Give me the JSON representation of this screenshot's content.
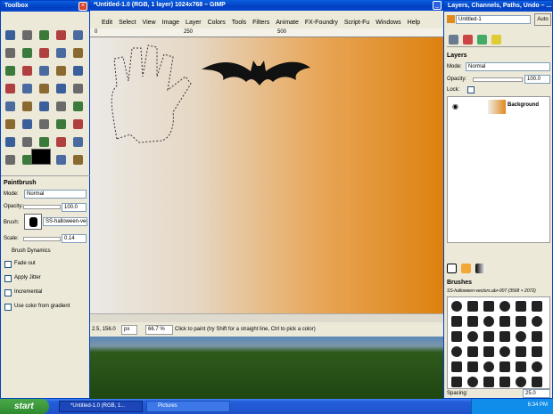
{
  "toolbox": {
    "title": "Toolbox",
    "paintbrush": "Paintbrush",
    "mode_label": "Mode:",
    "mode": "Normal",
    "opacity_label": "Opacity:",
    "opacity": "100.0",
    "brush_label": "Brush:",
    "brush": "SS-halloween-vect",
    "scale_label": "Scale:",
    "scale": "0.14",
    "dynamics": "Brush Dynamics",
    "fade": "Fade out",
    "jitter": "Apply Jitter",
    "incremental": "Incremental",
    "gradient": "Use color from gradient"
  },
  "image_window": {
    "title": "*Untitled-1.0 (RGB, 1 layer) 1024x768 – GIMP",
    "menu": [
      "Edit",
      "Select",
      "View",
      "Image",
      "Layer",
      "Colors",
      "Tools",
      "Filters",
      "Animate",
      "FX-Foundry",
      "Script-Fu",
      "Windows",
      "Help"
    ],
    "ruler": [
      "0",
      "250",
      "500"
    ],
    "coords": "2.5, 156.0",
    "unit": "px",
    "zoom": "66.7 %",
    "status": "Click to paint (try Shift for a straight line, Ctrl to pick a color)"
  },
  "dock": {
    "title": "Layers, Channels, Paths, Undo – ...",
    "image": "Untitled-1",
    "auto": "Auto",
    "layers_title": "Layers",
    "mode_label": "Mode:",
    "mode": "Normal",
    "opacity_label": "Opacity:",
    "opacity": "100.0",
    "lock_label": "Lock:",
    "layer_name": "Background",
    "brushes_title": "Brushes",
    "brush_name": "SS-halloween-vectors.abr-007 (3568 × 2072)",
    "spacing_label": "Spacing:",
    "spacing": "25.0"
  },
  "taskbar": {
    "start": "start",
    "items": [
      "*Untitled-1.0 (RGB, 1...",
      "Pictures"
    ],
    "clock": "6:34 PM"
  },
  "colors": {
    "orange": "#e08a1e",
    "accent": "#0040c0"
  }
}
